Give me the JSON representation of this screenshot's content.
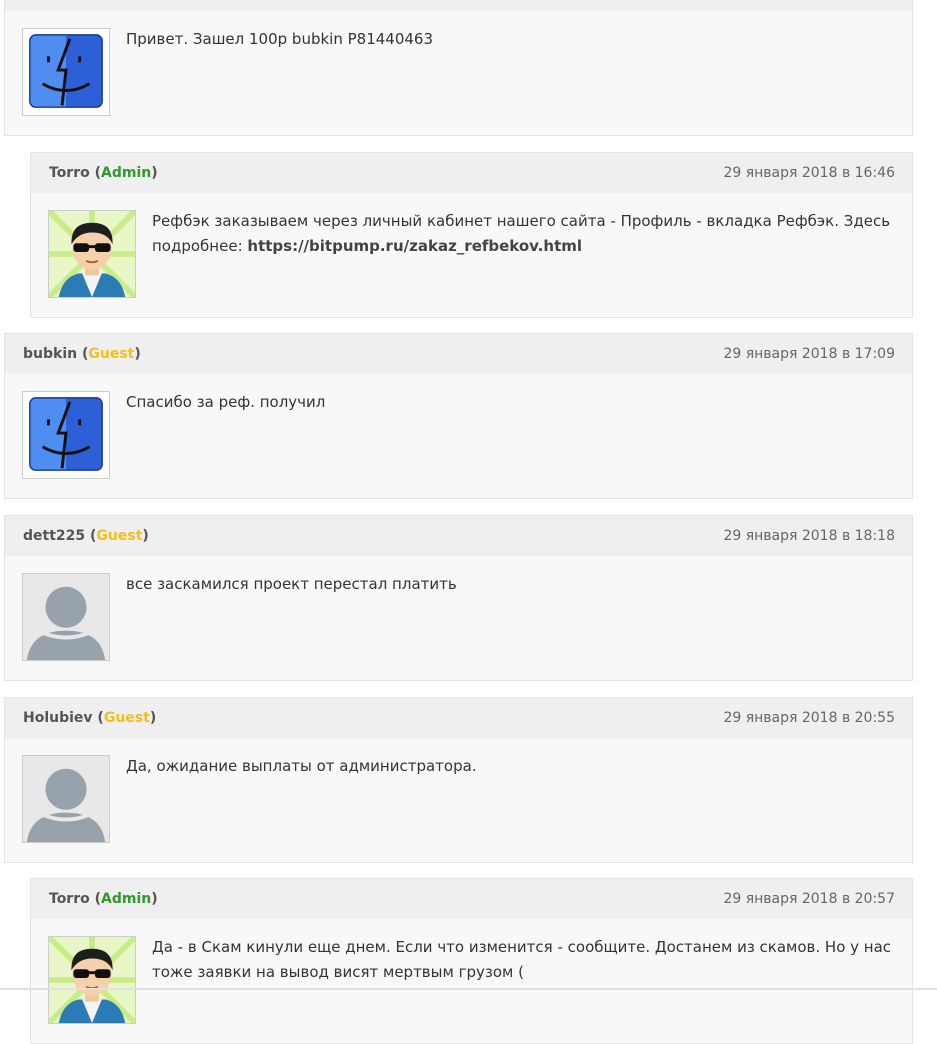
{
  "comments": [
    {
      "text": "Привет. Зашел 100р bubkin P81440463",
      "avatar": "finder-icon"
    },
    {
      "author": "Torro",
      "role": "Admin",
      "date": "29 января 2018 в 16:46",
      "text_before": "Рефбэк заказываем через личный кабинет нашего сайта - Профиль - вкладка Рефбэк. Здесь подробнее: ",
      "link": "https://bitpump.ru/zakaz_refbekov.html",
      "avatar": "admin-cartoon-avatar"
    },
    {
      "author": "bubkin",
      "role": "Guest",
      "date": "29 января 2018 в 17:09",
      "text": "Спасибо за реф. получил",
      "avatar": "finder-icon"
    },
    {
      "author": "dett225",
      "role": "Guest",
      "date": "29 января 2018 в 18:18",
      "text": "все заскамился проект перестал платить",
      "avatar": "default-user-icon"
    },
    {
      "author": "Holubiev",
      "role": "Guest",
      "date": "29 января 2018 в 20:55",
      "text": "Да, ожидание выплаты от администратора.",
      "avatar": "default-user-icon"
    },
    {
      "author": "Torro",
      "role": "Admin",
      "date": "29 января 2018 в 20:57",
      "text": "Да - в Скам кинули еще днем. Если что изменится - сообщите. Достанем из скамов. Но у нас тоже заявки на вывод висят мертвым грузом (",
      "avatar": "admin-cartoon-avatar"
    }
  ],
  "colors": {
    "guest": "#f0c020",
    "admin": "#2e9a2e",
    "header_bg": "#efefef",
    "body_bg": "#f8f8f8"
  }
}
